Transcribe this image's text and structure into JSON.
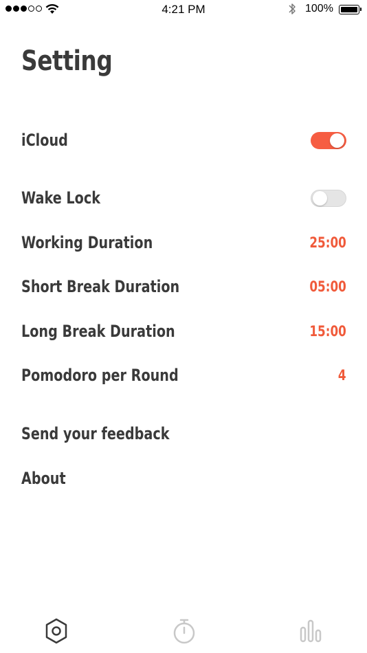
{
  "status_bar": {
    "time": "4:21 PM",
    "battery": "100%",
    "signal_dots_filled": 3,
    "signal_dots_total": 5
  },
  "header": {
    "title": "Setting"
  },
  "settings": {
    "icloud": {
      "label": "iCloud",
      "enabled": true
    },
    "wake_lock": {
      "label": "Wake Lock",
      "enabled": false
    },
    "working_duration": {
      "label": "Working Duration",
      "value": "25:00"
    },
    "short_break": {
      "label": "Short Break Duration",
      "value": "05:00"
    },
    "long_break": {
      "label": "Long Break Duration",
      "value": "15:00"
    },
    "pomodoro_per_round": {
      "label": "Pomodoro per Round",
      "value": "4"
    },
    "feedback": {
      "label": "Send your feedback"
    },
    "about": {
      "label": "About"
    }
  },
  "tab_bar": {
    "tabs": [
      {
        "icon": "settings-hexagon-icon",
        "active": true
      },
      {
        "icon": "stopwatch-icon",
        "active": false
      },
      {
        "icon": "bar-chart-icon",
        "active": false
      }
    ]
  },
  "colors": {
    "accent": "#f05a3a",
    "text": "#3a3a3a",
    "active_tab": "#3a3a3a",
    "inactive_tab": "#c8c8c8"
  }
}
